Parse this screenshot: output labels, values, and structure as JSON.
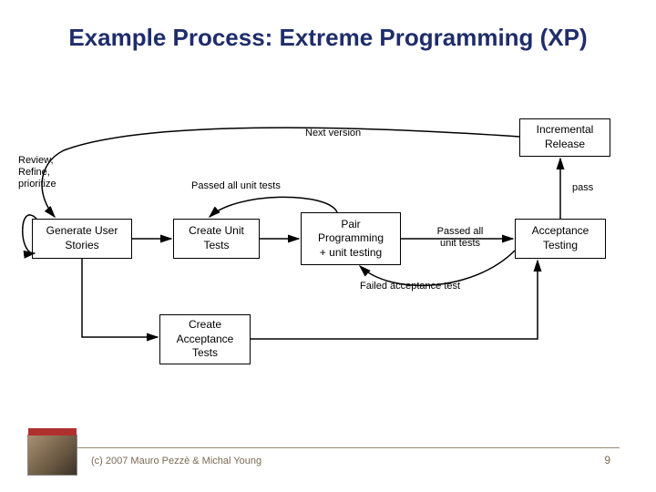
{
  "title": "Example Process: Extreme Programming (XP)",
  "boxes": {
    "gen_stories": "Generate User\nStories",
    "create_unit": "Create Unit\nTests",
    "pair": "Pair\nProgramming\n+ unit testing",
    "accept": "Acceptance\nTesting",
    "release": "Incremental\nRelease",
    "create_accept": "Create\nAcceptance\nTests"
  },
  "labels": {
    "next_version": "Next version",
    "review": "Review,\nRefine,\nprioritize",
    "passed_unit_top": "Passed all unit tests",
    "passed_unit_right": "Passed all\nunit tests",
    "pass": "pass",
    "failed": "Failed acceptance test"
  },
  "footer": {
    "copyright": "(c) 2007 Mauro Pezzè & Michal Young",
    "page": "9"
  }
}
